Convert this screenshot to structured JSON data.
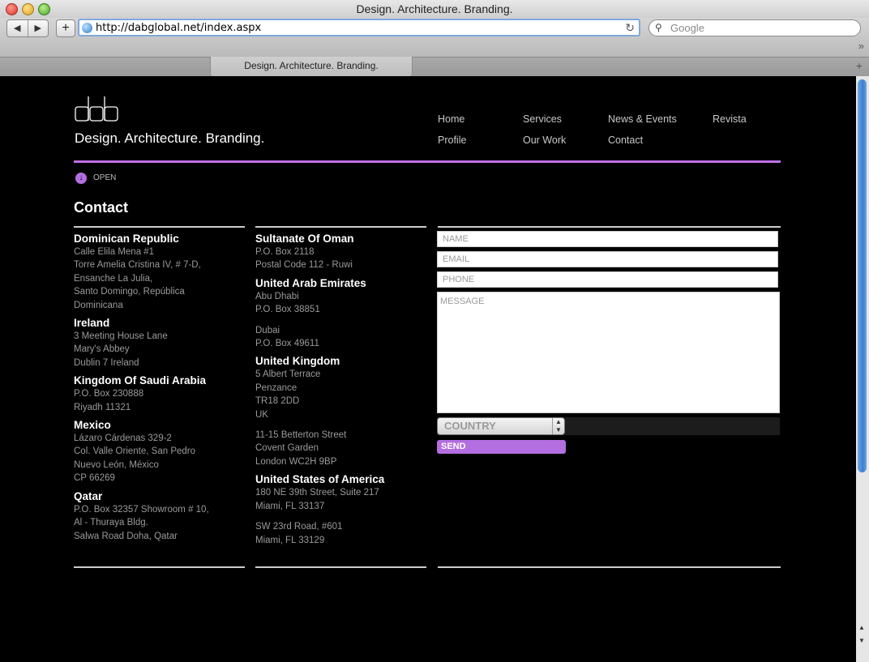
{
  "browser": {
    "window_title": "Design. Architecture. Branding.",
    "url": "http://dabglobal.net/index.aspx",
    "search_placeholder": "Google",
    "tab_title": "Design. Architecture. Branding.",
    "back_icon": "◀",
    "forward_icon": "▶",
    "add_icon": "+",
    "reload_icon": "↻",
    "overflow_icon": "»",
    "new_tab_icon": "+"
  },
  "site": {
    "logo_text": "dab",
    "tagline": "Design. Architecture. Branding.",
    "nav": [
      {
        "label": "Home"
      },
      {
        "label": "Services"
      },
      {
        "label": "News & Events"
      },
      {
        "label": "Revista"
      },
      {
        "label": "Profile"
      },
      {
        "label": "Our Work"
      },
      {
        "label": "Contact"
      }
    ],
    "open_label": "OPEN",
    "accent_color": "#c070e8"
  },
  "contact": {
    "title": "Contact",
    "column1": [
      {
        "country": "Dominican Republic",
        "lines": [
          "Calle Elila Mena #1",
          "Torre Amelia Cristina IV, # 7-D,",
          "Ensanche La Julia,",
          "Santo Domingo, República",
          "Dominicana"
        ]
      },
      {
        "country": "Ireland",
        "lines": [
          "3 Meeting House Lane",
          "Mary's Abbey",
          "Dublin 7 Ireland"
        ]
      },
      {
        "country": "Kingdom Of Saudi Arabia",
        "lines": [
          "P.O. Box 230888",
          "Riyadh 11321"
        ]
      },
      {
        "country": "Mexico",
        "lines": [
          "Lázaro Cárdenas 329-2",
          "Col. Valle Oriente, San Pedro",
          "Nuevo León, México",
          "CP 66269"
        ]
      },
      {
        "country": "Qatar",
        "lines": [
          "P.O. Box 32357 Showroom # 10,",
          "Al - Thuraya Bldg.",
          "Salwa Road Doha, Qatar"
        ]
      }
    ],
    "column2": [
      {
        "country": "Sultanate Of Oman",
        "lines": [
          "P.O. Box 2118",
          "Postal Code 112 - Ruwi"
        ]
      },
      {
        "country": "United Arab Emirates",
        "lines": [
          "Abu Dhabi",
          "P.O. Box 38851"
        ],
        "extra": [
          "Dubai",
          "P.O. Box 49611"
        ]
      },
      {
        "country": "United Kingdom",
        "lines": [
          "5 Albert Terrace",
          "Penzance",
          "TR18 2DD",
          "UK"
        ],
        "extra": [
          "11-15 Betterton Street",
          "Covent Garden",
          "London WC2H 9BP"
        ]
      },
      {
        "country": "United States of America",
        "lines": [
          "180 NE 39th Street, Suite 217",
          "Miami, FL 33137"
        ],
        "extra": [
          "SW 23rd Road, #601",
          "Miami, FL 33129"
        ]
      }
    ],
    "form": {
      "name_placeholder": "NAME",
      "email_placeholder": "EMAIL",
      "phone_placeholder": "PHONE",
      "message_placeholder": "MESSAGE",
      "country_value": "COUNTRY",
      "send_label": "SEND"
    }
  }
}
